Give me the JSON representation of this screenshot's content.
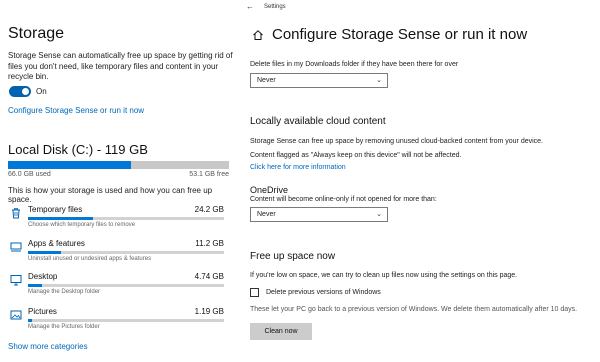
{
  "left": {
    "heading": "Storage",
    "description": "Storage Sense can automatically free up space by getting rid of files you don't need, like temporary files and content in your recycle bin.",
    "toggle_label": "On",
    "configure_link": "Configure Storage Sense or run it now",
    "disk": {
      "title": "Local Disk (C:) - 119 GB",
      "used": "66.0 GB used",
      "free": "53.1 GB free",
      "used_fraction": 0.555,
      "help": "This is how your storage is used and how you can free up space."
    },
    "categories": [
      {
        "name": "Temporary files",
        "size": "24.2 GB",
        "sub": "Choose which temporary files to remove",
        "icon": "trash-icon",
        "fill": 0.33
      },
      {
        "name": "Apps & features",
        "size": "11.2 GB",
        "sub": "Uninstall unused or undesired apps & features",
        "icon": "apps-icon",
        "fill": 0.17
      },
      {
        "name": "Desktop",
        "size": "4.74 GB",
        "sub": "Manage the Desktop folder",
        "icon": "desktop-icon",
        "fill": 0.07
      },
      {
        "name": "Pictures",
        "size": "1.19 GB",
        "sub": "Manage the Pictures folder",
        "icon": "pictures-icon",
        "fill": 0.02
      }
    ],
    "more_link": "Show more categories"
  },
  "right": {
    "app_title": "Settings",
    "page_title": "Configure Storage Sense or run it now",
    "downloads_label": "Delete files in my Downloads folder if they have been there for over",
    "downloads_value": "Never",
    "cloud_heading": "Locally available cloud content",
    "cloud_text1": "Storage Sense can free up space by removing unused cloud-backed content from your device.",
    "cloud_text2": "Content flagged as \"Always keep on this device\" will not be affected.",
    "cloud_link": "Click here for more information",
    "onedrive_heading": "OneDrive",
    "onedrive_label": "Content will become online-only if not opened for more than:",
    "onedrive_value": "Never",
    "free_heading": "Free up space now",
    "free_text": "If you're low on space, we can try to clean up files now using the settings on this page.",
    "checkbox_label": "Delete previous versions of Windows",
    "checkbox_checked": false,
    "checkbox_help": "These let your PC go back to a previous version of Windows. We delete them automatically after 10 days.",
    "button_label": "Clean now"
  },
  "colors": {
    "accent": "#0078d7",
    "link": "#0067b8",
    "track": "#c8c8c8"
  }
}
